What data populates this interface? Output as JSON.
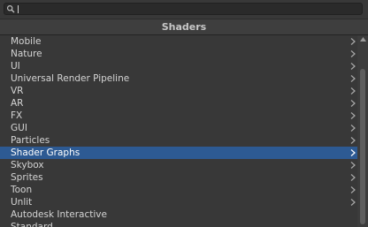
{
  "search": {
    "value": ""
  },
  "header": {
    "title": "Shaders"
  },
  "list": {
    "items": [
      {
        "label": "Mobile",
        "has_submenu": true
      },
      {
        "label": "Nature",
        "has_submenu": true
      },
      {
        "label": "UI",
        "has_submenu": true
      },
      {
        "label": "Universal Render Pipeline",
        "has_submenu": true
      },
      {
        "label": "VR",
        "has_submenu": true
      },
      {
        "label": "AR",
        "has_submenu": true
      },
      {
        "label": "FX",
        "has_submenu": true
      },
      {
        "label": "GUI",
        "has_submenu": true
      },
      {
        "label": "Particles",
        "has_submenu": true
      },
      {
        "label": "Shader Graphs",
        "has_submenu": true,
        "selected": true
      },
      {
        "label": "Skybox",
        "has_submenu": true
      },
      {
        "label": "Sprites",
        "has_submenu": true
      },
      {
        "label": "Toon",
        "has_submenu": true
      },
      {
        "label": "Unlit",
        "has_submenu": true
      },
      {
        "label": "Autodesk Interactive",
        "has_submenu": false
      },
      {
        "label": "Standard",
        "has_submenu": false
      }
    ]
  },
  "colors": {
    "selection": "#2d5a93",
    "background": "#383838",
    "text": "#d4d4d4"
  },
  "icons": {
    "search": "search-icon",
    "submenu": "chevron-right-icon",
    "scroll_up": "scroll-up-arrow-icon"
  }
}
